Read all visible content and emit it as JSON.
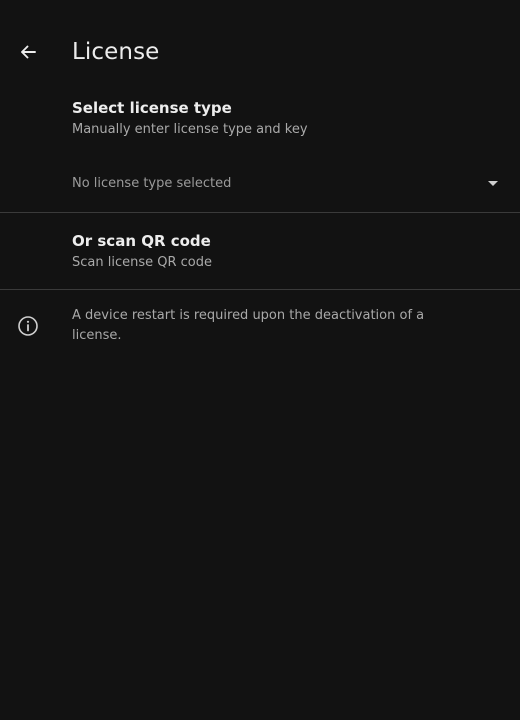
{
  "header": {
    "title": "License",
    "back_icon": "arrow-left-icon"
  },
  "license_type": {
    "title": "Select license type",
    "subtitle": "Manually enter license type and key",
    "dropdown": {
      "selected": "No license type selected",
      "icon": "caret-down-icon"
    }
  },
  "qr": {
    "title": "Or scan QR code",
    "subtitle": "Scan license QR code"
  },
  "info": {
    "icon": "info-icon",
    "text": "A device restart is required upon the deactivation of a license."
  },
  "colors": {
    "background": "#121212",
    "text_primary": "#ececec",
    "text_secondary": "#a9a9a9",
    "divider": "#3a3a3a"
  }
}
